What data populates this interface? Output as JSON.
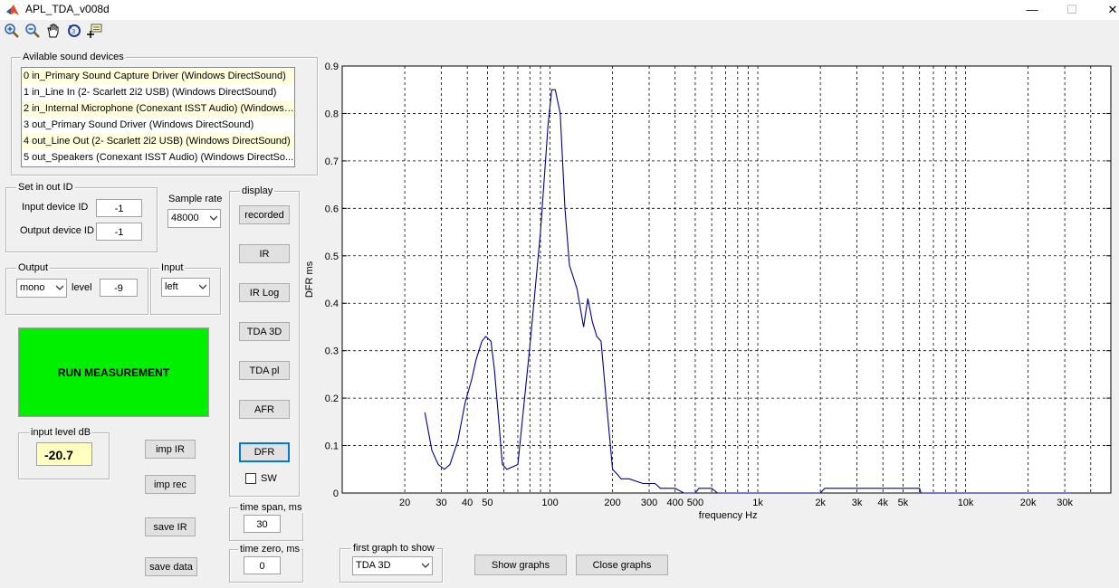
{
  "window": {
    "title": "APL_TDA_v008d",
    "minimize": "—",
    "maximize": "☐",
    "close": "✕"
  },
  "toolbar": {
    "icons": [
      "zoom-in-icon",
      "zoom-out-icon",
      "pan-icon",
      "rotate-icon",
      "data-cursor-icon"
    ]
  },
  "devices": {
    "legend": "Avilable sound devices",
    "items": [
      "0 in_Primary Sound Capture Driver (Windows DirectSound)",
      "1 in_Line In (2- Scarlett 2i2 USB) (Windows DirectSound)",
      "2 in_Internal Microphone (Conexant ISST Audio) (Windows ...",
      "3 out_Primary Sound Driver (Windows DirectSound)",
      "4 out_Line Out (2- Scarlett 2i2 USB) (Windows DirectSound)",
      "5 out_Speakers (Conexant ISST Audio) (Windows DirectSo..."
    ]
  },
  "ids": {
    "legend": "Set in out ID",
    "input_label": "Input device ID",
    "input_value": "-1",
    "output_label": "Output device ID",
    "output_value": "-1"
  },
  "sample_rate": {
    "label": "Sample rate",
    "value": "48000"
  },
  "output": {
    "legend": "Output",
    "channel": "mono",
    "level_label": "level",
    "level_value": "-9"
  },
  "input": {
    "legend": "Input",
    "channel": "left"
  },
  "run_label": "RUN MEASUREMENT",
  "input_level": {
    "legend": "input level dB",
    "value": "-20.7"
  },
  "buttons": {
    "imp_ir": "imp IR",
    "imp_rec": "imp rec",
    "save_ir": "save IR",
    "save_data": "save data"
  },
  "display": {
    "legend": "display",
    "buttons": [
      "recorded",
      "IR",
      "IR Log",
      "TDA 3D",
      "TDA pl",
      "AFR",
      "DFR"
    ],
    "sw_label": "SW"
  },
  "time_span": {
    "legend": "time span, ms",
    "value": "30"
  },
  "time_zero": {
    "legend": "time zero, ms",
    "value": "0"
  },
  "first_graph": {
    "legend": "first graph to show",
    "value": "TDA 3D"
  },
  "show_graphs": "Show graphs",
  "close_graphs": "Close graphs",
  "chart_data": {
    "type": "line",
    "xlabel": "frequency  Hz",
    "ylabel": "DFR ms",
    "xscale": "log",
    "xlim": [
      10,
      50000
    ],
    "ylim": [
      0,
      0.9
    ],
    "grid": true,
    "xticks": [
      20,
      30,
      40,
      50,
      100,
      200,
      300,
      400,
      500,
      1000,
      2000,
      3000,
      4000,
      5000,
      10000,
      20000,
      30000
    ],
    "xtick_labels": [
      "20",
      "30",
      "40",
      "50",
      "100",
      "200",
      "300",
      "400",
      "500",
      "1k",
      "2k",
      "3k",
      "4k",
      "5k",
      "10k",
      "20k",
      "30k"
    ],
    "yticks": [
      0,
      0.1,
      0.2,
      0.3,
      0.4,
      0.5,
      0.6,
      0.7,
      0.8,
      0.9
    ],
    "ytick_labels": [
      "0",
      "0.1",
      "0.2",
      "0.3",
      "0.4",
      "0.5",
      "0.6",
      "0.7",
      "0.8",
      "0.9"
    ],
    "line_color": "#00008b",
    "series": [
      {
        "x": [
          25,
          27,
          29,
          31,
          33,
          36,
          39,
          42,
          44,
          47,
          49,
          52,
          54,
          56,
          59,
          62,
          70,
          80,
          90,
          98,
          102,
          106,
          112,
          118,
          124,
          135,
          145,
          152,
          160,
          168,
          176,
          186,
          200,
          210,
          220,
          240,
          280,
          320,
          340,
          400,
          440,
          500,
          520,
          600,
          640,
          660,
          1000,
          2000,
          2100,
          2400,
          3000,
          4000,
          5000,
          6000,
          6100,
          10000,
          20000,
          30000,
          32000
        ],
        "y": [
          0.17,
          0.09,
          0.06,
          0.05,
          0.06,
          0.11,
          0.19,
          0.24,
          0.28,
          0.32,
          0.33,
          0.32,
          0.26,
          0.18,
          0.06,
          0.05,
          0.06,
          0.31,
          0.55,
          0.78,
          0.85,
          0.85,
          0.8,
          0.6,
          0.48,
          0.43,
          0.35,
          0.41,
          0.36,
          0.33,
          0.32,
          0.2,
          0.05,
          0.04,
          0.03,
          0.03,
          0.02,
          0.02,
          0.01,
          0.01,
          0.0,
          0.0,
          0.01,
          0.01,
          0.0,
          0.0,
          0.0,
          0.0,
          0.01,
          0.01,
          0.01,
          0.01,
          0.01,
          0.01,
          0.0,
          0.0,
          0.0,
          0.0,
          0.0
        ]
      }
    ]
  }
}
